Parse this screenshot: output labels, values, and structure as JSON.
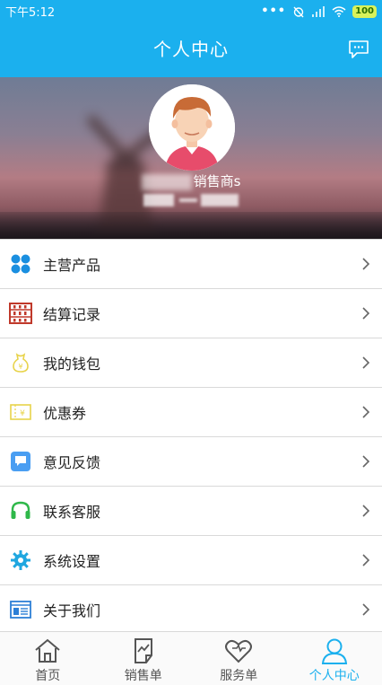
{
  "status_bar": {
    "time": "下午5:12",
    "battery": "100"
  },
  "header": {
    "title": "个人中心"
  },
  "profile": {
    "name_suffix": "销售商s"
  },
  "menu": [
    {
      "label": "主营产品",
      "icon": "grid-icon"
    },
    {
      "label": "结算记录",
      "icon": "abacus-icon"
    },
    {
      "label": "我的钱包",
      "icon": "wallet-icon"
    },
    {
      "label": "优惠券",
      "icon": "coupon-icon"
    },
    {
      "label": "意见反馈",
      "icon": "feedback-icon"
    },
    {
      "label": "联系客服",
      "icon": "headset-icon"
    },
    {
      "label": "系统设置",
      "icon": "gear-icon"
    },
    {
      "label": "关于我们",
      "icon": "about-icon"
    }
  ],
  "tabs": [
    {
      "label": "首页",
      "icon": "home-icon"
    },
    {
      "label": "销售单",
      "icon": "sales-order-icon"
    },
    {
      "label": "服务单",
      "icon": "heart-icon"
    },
    {
      "label": "个人中心",
      "icon": "person-icon",
      "active": true
    }
  ],
  "colors": {
    "accent": "#1bb0ee"
  }
}
